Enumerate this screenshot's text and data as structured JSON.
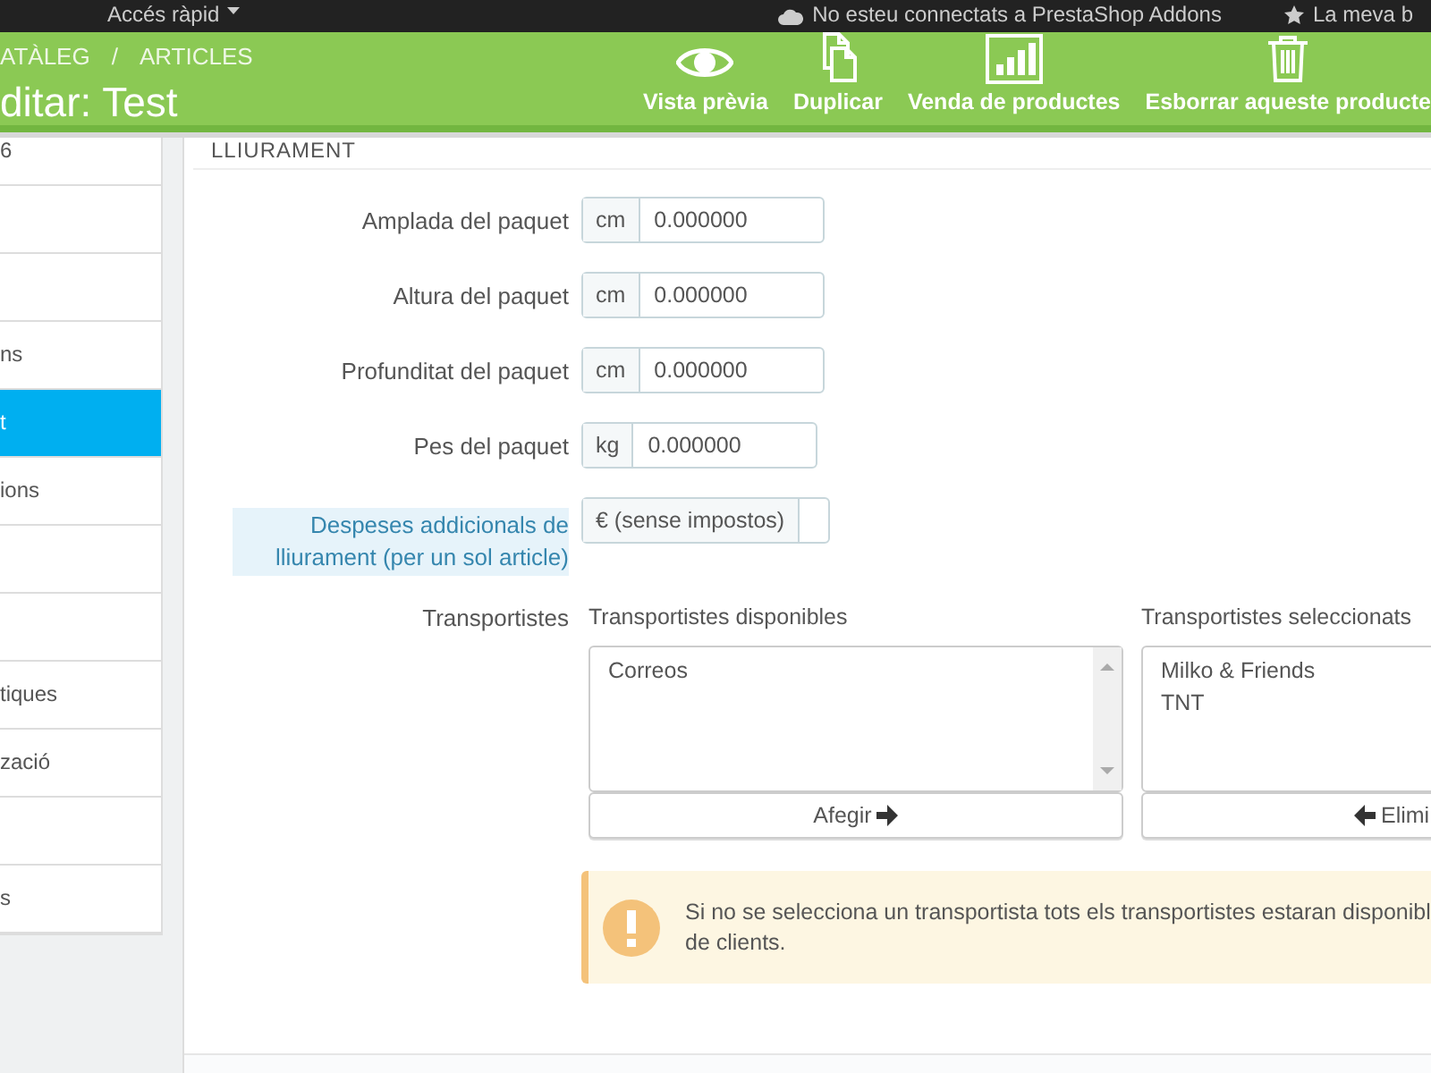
{
  "top_bar": {
    "quick_access": "Accés ràpid",
    "addons_status": "No esteu connectats a PrestaShop Addons",
    "account": "La meva b"
  },
  "breadcrumb": {
    "items": [
      "ATÀLEG",
      "ARTICLES"
    ],
    "separator": "/"
  },
  "page_title": "ditar: Test",
  "toolbar": [
    {
      "kind": "preview",
      "label": "Vista prèvia"
    },
    {
      "kind": "duplicate",
      "label": "Duplicar"
    },
    {
      "kind": "sales",
      "label": "Venda de productes"
    },
    {
      "kind": "delete",
      "label": "Esborrar aqueste producte"
    }
  ],
  "sidebar": {
    "items": [
      {
        "label": "6",
        "selected": false
      },
      {
        "selected": false
      },
      {
        "selected": false
      },
      {
        "label": "ns",
        "selected": false
      },
      {
        "label": "t",
        "selected": true
      },
      {
        "label": "ions",
        "selected": false
      },
      {
        "selected": false
      },
      {
        "selected": false
      },
      {
        "label": "tiques",
        "selected": false
      },
      {
        "label": "zació",
        "selected": false
      },
      {
        "selected": false
      },
      {
        "label": "s",
        "selected": false
      }
    ]
  },
  "section_title": "LLIURAMENT",
  "fields": [
    {
      "label": "Amplada del paquet",
      "unit": "cm",
      "value": "0.000000",
      "highlighted": false
    },
    {
      "label": "Altura del paquet",
      "unit": "cm",
      "value": "0.000000",
      "highlighted": false
    },
    {
      "label": "Profunditat del paquet",
      "unit": "cm",
      "value": "0.000000",
      "highlighted": false
    },
    {
      "label": "Pes del paquet",
      "unit": "kg",
      "value": "0.000000",
      "highlighted": false
    },
    {
      "label": "Despeses addicionals de lliurament (per un sol article)",
      "unit": "€ (sense impostos)",
      "highlighted": true
    }
  ],
  "carriers": {
    "label": "Transportistes",
    "available": {
      "title": "Transportistes disponibles",
      "items": [
        "Correos"
      ],
      "button": "Afegir"
    },
    "selected": {
      "title": "Transportistes seleccionats",
      "items": [
        "Milko & Friends",
        "TNT"
      ],
      "button": "Elimi"
    }
  },
  "alert": {
    "lines": [
      "Si no se selecciona un transportista tots els transportistes estaran disponibl",
      "de clients."
    ]
  }
}
